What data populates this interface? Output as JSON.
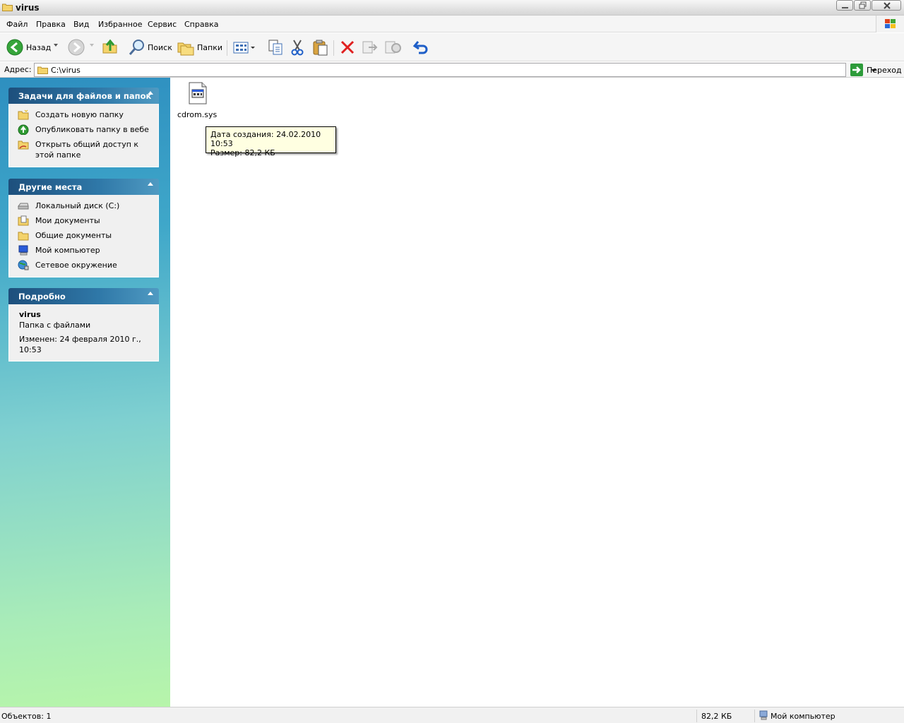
{
  "window": {
    "title": "virus"
  },
  "menu": [
    "Файл",
    "Правка",
    "Вид",
    "Избранное",
    "Сервис",
    "Справка"
  ],
  "toolbar": {
    "back_label": "Назад",
    "search_label": "Поиск",
    "folders_label": "Папки"
  },
  "address": {
    "label": "Адрес:",
    "value": "C:\\virus",
    "go_label": "Переход"
  },
  "panels": {
    "tasks": {
      "title": "Задачи для файлов и папок",
      "items": [
        "Создать новую папку",
        "Опубликовать папку в вебе",
        "Открыть общий доступ к этой папке"
      ]
    },
    "places": {
      "title": "Другие места",
      "items": [
        "Локальный диск (C:)",
        "Мои документы",
        "Общие документы",
        "Мой компьютер",
        "Сетевое окружение"
      ]
    },
    "details": {
      "title": "Подробно",
      "name": "virus",
      "type": "Папка с файлами",
      "modified": "Изменен: 24 февраля 2010 г., 10:53"
    }
  },
  "files": [
    {
      "name": "cdrom.sys"
    }
  ],
  "tooltip": {
    "line1": "Дата создания: 24.02.2010 10:53",
    "line2": "Размер: 82,2 КБ"
  },
  "status": {
    "objects": "Объектов: 1",
    "size": "82,2 КБ",
    "location": "Мой компьютер"
  },
  "colors": {
    "panel_header": "#2f78a8",
    "tooltip_bg": "#ffffe1",
    "delete_icon": "#e02020",
    "undo_icon": "#1f5fc8"
  }
}
